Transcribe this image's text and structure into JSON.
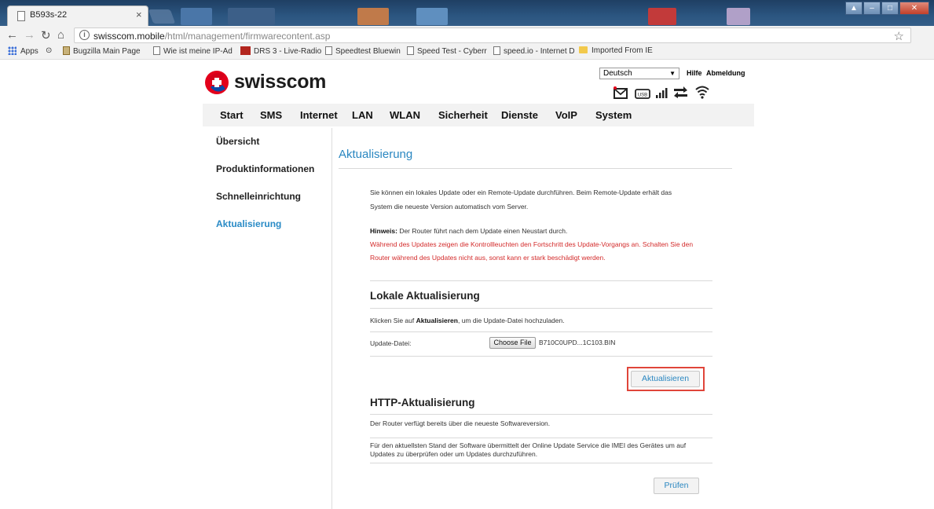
{
  "browser": {
    "tab_title": "B593s-22",
    "tab_close": "×",
    "url_host": "swisscom.mobile",
    "url_path": "/html/management/firmwarecontent.asp",
    "bookmarks": [
      {
        "label": "Apps",
        "icon": "apps-icon"
      },
      {
        "label": "",
        "icon": "history-icon"
      },
      {
        "label": "Bugzilla Main Page",
        "icon": "bugzilla-icon"
      },
      {
        "label": "Wie ist meine IP-Ad",
        "icon": "page-icon"
      },
      {
        "label": "DRS 3 - Live-Radio",
        "icon": "srf-icon"
      },
      {
        "label": "Speedtest Bluewin",
        "icon": "page-icon"
      },
      {
        "label": "Speed Test - Cyberr",
        "icon": "page-icon"
      },
      {
        "label": "speed.io - Internet D",
        "icon": "page-icon"
      },
      {
        "label": "Imported From IE",
        "icon": "folder-icon"
      }
    ]
  },
  "header": {
    "logo_text": "swisscom",
    "language": "Deutsch",
    "help": "Hilfe",
    "logout": "Abmeldung",
    "brand_red": "#e3001b"
  },
  "menu": [
    "Start",
    "SMS",
    "Internet",
    "LAN",
    "WLAN",
    "Sicherheit",
    "Dienste",
    "VoIP",
    "System"
  ],
  "sidebar": [
    {
      "label": "Übersicht",
      "active": false
    },
    {
      "label": "Produktinformationen",
      "active": false
    },
    {
      "label": "Schnelleinrichtung",
      "active": false
    },
    {
      "label": "Aktualisierung",
      "active": true
    }
  ],
  "main": {
    "title": "Aktualisierung",
    "intro_line1": "Sie können ein lokales Update oder ein Remote-Update durchführen. Beim Remote-Update erhält das",
    "intro_line2": "System die neueste Version automatisch vom Server.",
    "note_label": "Hinweis:",
    "note_text": " Der Router führt nach dem Update einen Neustart durch.",
    "warning_line1": "Während des Updates zeigen die Kontrollleuchten den Fortschritt des Update-Vorgangs an. Schalten Sie den",
    "warning_line2": "Router während des Updates nicht aus, sonst kann er stark beschädigt werden.",
    "local": {
      "heading": "Lokale Aktualisierung",
      "instr_pre": "Klicken Sie auf ",
      "instr_bold": "Aktualisieren",
      "instr_post": ", um die Update-Datei hochzuladen.",
      "file_label": "Update-Datei:",
      "choose_file": "Choose File",
      "file_name": "B710C0UPD...1C103.BIN",
      "button": "Aktualisieren"
    },
    "http": {
      "heading": "HTTP-Aktualisierung",
      "status": "Der Router verfügt bereits über die neueste Softwareversion.",
      "info_line1": "Für den aktuellsten Stand der Software übermittelt der Online Update Service die IMEI des Gerätes um auf",
      "info_line2": "Updates zu überprüfen oder um Updates durchzuführen.",
      "button": "Prüfen"
    }
  }
}
